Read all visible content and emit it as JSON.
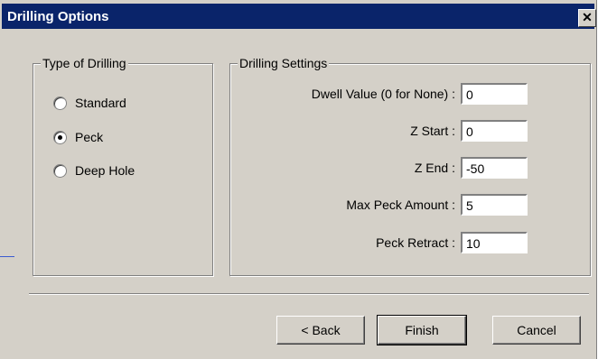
{
  "window": {
    "title": "Drilling Options",
    "close_glyph": "✕"
  },
  "type_group": {
    "label": "Type of Drilling",
    "options": [
      {
        "label": "Standard",
        "checked": false
      },
      {
        "label": "Peck",
        "checked": true
      },
      {
        "label": "Deep Hole",
        "checked": false
      }
    ]
  },
  "settings_group": {
    "label": "Drilling Settings",
    "fields": [
      {
        "label": "Dwell Value (0 for None) :",
        "value": "0"
      },
      {
        "label": "Z Start :",
        "value": "0"
      },
      {
        "label": "Z End :",
        "value": "-50"
      },
      {
        "label": "Max Peck Amount :",
        "value": "5"
      },
      {
        "label": "Peck Retract :",
        "value": "10"
      }
    ]
  },
  "buttons": {
    "back": "< Back",
    "finish": "Finish",
    "cancel": "Cancel"
  }
}
